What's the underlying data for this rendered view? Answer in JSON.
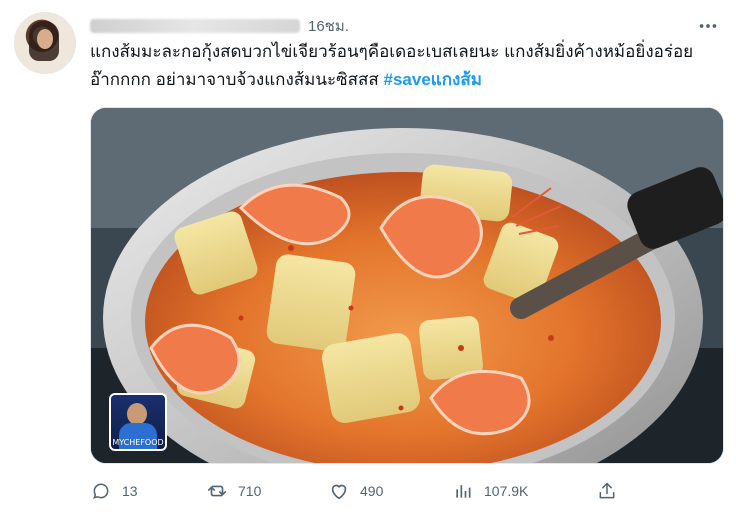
{
  "tweet": {
    "time": "16ชม.",
    "text_line1": "แกงส้มมะละกอกุ้งสดบวกไข่เจียวร้อนๆคือเดอะเบสเลยนะ แกงส้มยิ่งค้างหม้อยิ่งอร่อย",
    "text_line2": "อ๊ากกกก อย่ามาจาบจ้วงแกงส้มนะซิสสส",
    "hashtag": "#saveแกงส้ม",
    "more_icon": "more-icon"
  },
  "media": {
    "alt": "curry soup with shrimp in pot",
    "watermark_label": "MYCHEFOOD"
  },
  "actions": {
    "reply_count": "13",
    "retweet_count": "710",
    "like_count": "490",
    "view_count": "107.9K"
  },
  "colors": {
    "accent": "#1d9bf0",
    "muted": "#536471",
    "text": "#0f1419"
  }
}
